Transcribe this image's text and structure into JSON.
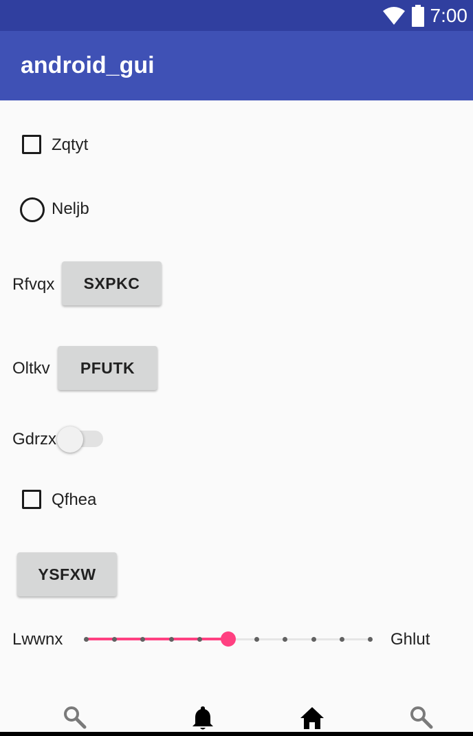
{
  "status_bar": {
    "time": "7:00"
  },
  "app_bar": {
    "title": "android_gui"
  },
  "content": {
    "checkbox1": {
      "label": "Zqtyt",
      "checked": false
    },
    "radio1": {
      "label": "Neljb",
      "checked": false
    },
    "row1": {
      "label": "Rfvqx",
      "button": "SXPKC"
    },
    "row2": {
      "label": "Oltkv",
      "button": "PFUTK"
    },
    "switch1": {
      "label": "Gdrzx",
      "on": false
    },
    "checkbox2": {
      "label": "Qfhea",
      "checked": false
    },
    "button3": {
      "label": "YSFXW"
    },
    "seekbar": {
      "left_label": "Lwwnx",
      "right_label": "Ghlut",
      "value": 5,
      "max": 10
    }
  },
  "bottom_nav": {
    "items": [
      {
        "icon": "search-icon"
      },
      {
        "icon": "bell-icon"
      },
      {
        "icon": "home-icon"
      },
      {
        "icon": "search-icon"
      }
    ]
  },
  "colors": {
    "status_bar": "#303f9f",
    "app_bar": "#3f51b5",
    "accent": "#ff4081",
    "button_bg": "#d6d7d7"
  }
}
